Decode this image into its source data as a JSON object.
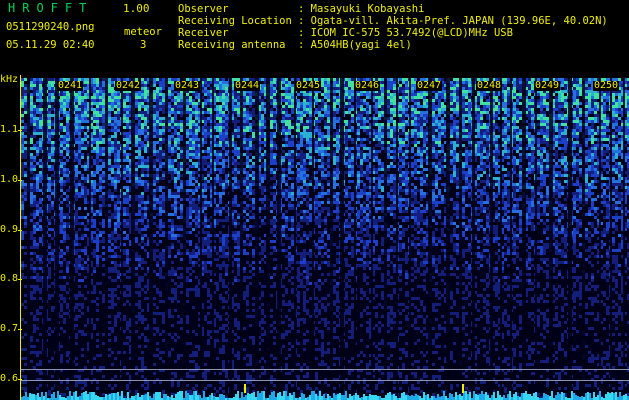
{
  "header": {
    "app_title": "HROFFT",
    "version": "1.00",
    "file_name": "0511290240.png",
    "date_time": "05.11.29 02:40",
    "meteor_label": "meteor",
    "meteor_count": "3",
    "info": [
      {
        "label": "Observer",
        "value": ": Masayuki Kobayashi"
      },
      {
        "label": "Receiving Location",
        "value": ": Ogata-vill. Akita-Pref. JAPAN (139.96E, 40.02N)"
      },
      {
        "label": "Receiver",
        "value": ": ICOM IC-575 53.7492(@LCD)MHz USB"
      },
      {
        "label": "Receiving antenna",
        "value": ": A504HB(yagi 4el)"
      }
    ]
  },
  "axis": {
    "unit": "kHz",
    "y_labels": [
      "1.1",
      "1.0",
      "0.9",
      "0.8",
      "0.7",
      "0.6"
    ],
    "x_labels": [
      "0241",
      "0242",
      "0243",
      "0244",
      "0245",
      "0246",
      "0247",
      "0248",
      "0249",
      "0250"
    ]
  },
  "colors": {
    "text": "#f0ef00",
    "background": "#000000",
    "title": "#00d050"
  }
}
